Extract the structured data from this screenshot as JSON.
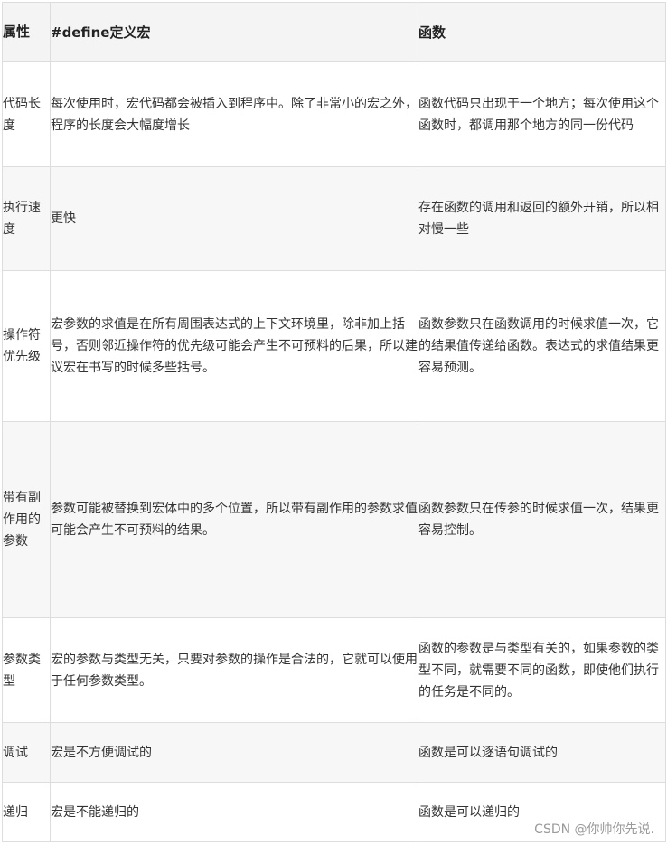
{
  "header": {
    "attribute": "属性",
    "macro": "#define定义宏",
    "function": "函数"
  },
  "rows": [
    {
      "attribute": "代码长度",
      "macro": "每次使用时，宏代码都会被插入到程序中。除了非常小的宏之外，程序的长度会大幅度增长",
      "function": "函数代码只出现于一个地方；每次使用这个函数时，都调用那个地方的同一份代码"
    },
    {
      "attribute": "执行速度",
      "macro": "更快",
      "function": "存在函数的调用和返回的额外开销，所以相对慢一些"
    },
    {
      "attribute": "操作符优先级",
      "macro": "宏参数的求值是在所有周围表达式的上下文环境里，除非加上括号，否则邻近操作符的优先级可能会产生不可预料的后果，所以建议宏在书写的时候多些括号。",
      "function": "函数参数只在函数调用的时候求值一次，它的结果值传递给函数。表达式的求值结果更容易预测。"
    },
    {
      "attribute": "带有副作用的参数",
      "macro": "参数可能被替换到宏体中的多个位置，所以带有副作用的参数求值可能会产生不可预料的结果。",
      "function": "函数参数只在传参的时候求值一次，结果更容易控制。"
    },
    {
      "attribute": "参数类型",
      "macro": "宏的参数与类型无关，只要对参数的操作是合法的，它就可以使用于任何参数类型。",
      "function": "函数的参数是与类型有关的，如果参数的类型不同，就需要不同的函数，即使他们执行的任务是不同的。"
    },
    {
      "attribute": "调试",
      "macro": "宏是不方便调试的",
      "function": "函数是可以逐语句调试的"
    },
    {
      "attribute": "递归",
      "macro": "宏是不能递归的",
      "function": "函数是可以递归的"
    }
  ],
  "watermark": "CSDN @你帅你先说."
}
